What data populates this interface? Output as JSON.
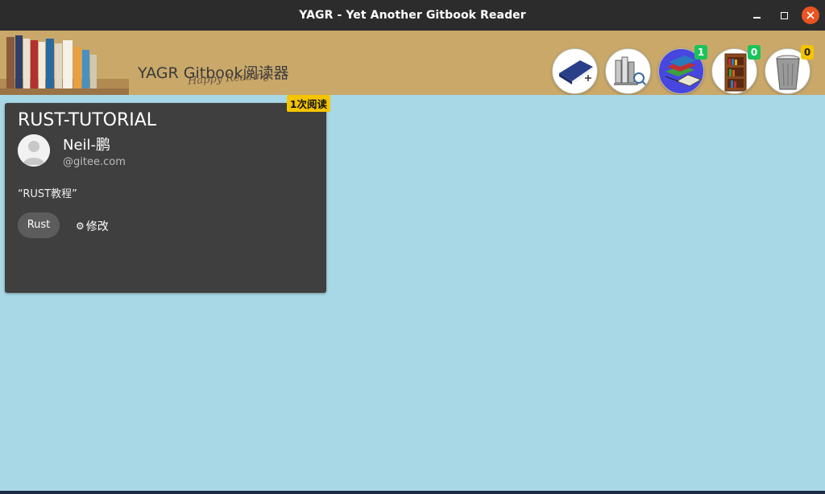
{
  "window": {
    "title": "YAGR - Yet Another Gitbook Reader"
  },
  "header": {
    "brand": "YAGR Gitbook阅读器",
    "tagline": "Happy Reading!",
    "icons": [
      {
        "name": "add-book-icon"
      },
      {
        "name": "search-library-icon"
      },
      {
        "name": "reading-books-icon",
        "badge": "1"
      },
      {
        "name": "bookshelf-icon",
        "badge": "0"
      },
      {
        "name": "trash-icon",
        "badge": "0"
      }
    ]
  },
  "card": {
    "read_count": "1次阅读",
    "title": "RUST-TUTORIAL",
    "author": "Neil-鹏",
    "source": "@gitee.com",
    "description": "“RUST教程”",
    "tag": "Rust",
    "edit_label": "修改"
  },
  "colors": {
    "background": "#a8d8e6",
    "card": "#3f3f3f",
    "header": "#c9a86a",
    "badge_green": "#19c45a",
    "badge_yellow": "#f5c400",
    "close_button": "#e95420"
  }
}
